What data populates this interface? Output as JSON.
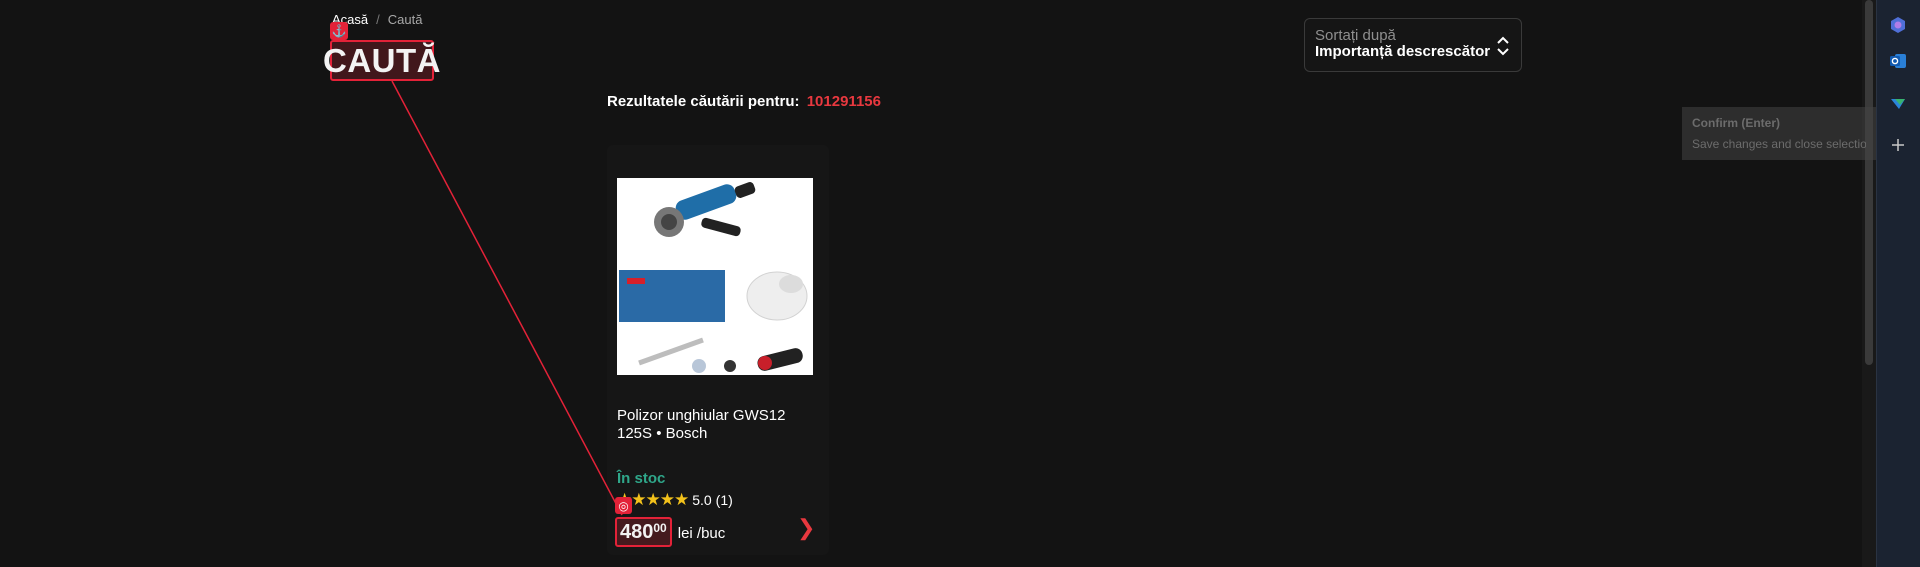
{
  "breadcrumb": {
    "home": "Acasă",
    "separator": "/",
    "current": "Caută"
  },
  "page": {
    "title": "CAUTĂ"
  },
  "sort": {
    "label": "Sortați după",
    "value": "Importanță descrescător"
  },
  "results": {
    "prefix": "Rezultatele căutării pentru:",
    "query": "101291156"
  },
  "product": {
    "name": "Polizor unghiular GWS12 125S • Bosch",
    "stock": "În stoc",
    "stars": "★★★★★",
    "rating": "5.0",
    "reviews": "(1)",
    "price_int": "480",
    "price_dec": "00",
    "price_unit": "lei /buc",
    "next_icon": "chevron-right-icon"
  },
  "tooltip": {
    "title": "Confirm (Enter)",
    "description": "Save changes and close selection wizard"
  },
  "annotations": {
    "anchor_icon": "anchor-icon",
    "target_icon": "target-icon"
  },
  "colors": {
    "accent": "#e8383f",
    "annotation": "#e32238",
    "stock": "#2fa78a",
    "star": "#f3c21b"
  }
}
